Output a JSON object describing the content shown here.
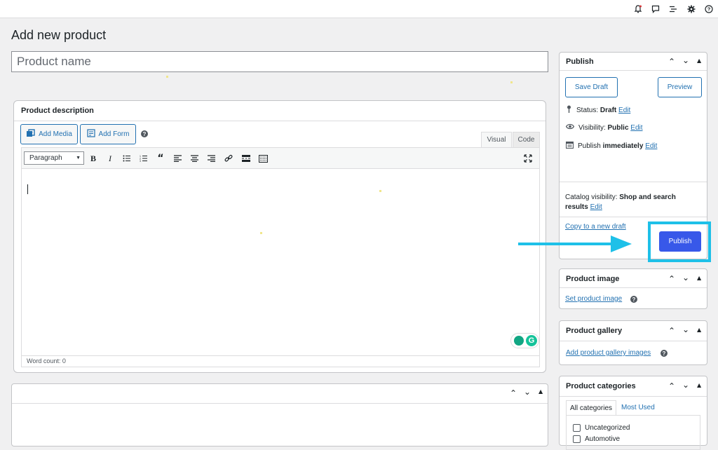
{
  "page": {
    "title": "Add new product"
  },
  "product_name": {
    "placeholder": "Product name",
    "value": ""
  },
  "description": {
    "title": "Product description",
    "add_media_label": "Add Media",
    "add_form_label": "Add Form",
    "tabs": {
      "visual": "Visual",
      "code": "Code"
    },
    "format_select": "Paragraph",
    "word_count": "Word count: 0"
  },
  "publish_box": {
    "title": "Publish",
    "save_draft_label": "Save Draft",
    "preview_label": "Preview",
    "status_label": "Status:",
    "status_value": "Draft",
    "visibility_label": "Visibility:",
    "visibility_value": "Public",
    "publish_label": "Publish",
    "publish_value": "immediately",
    "edit_label": "Edit",
    "catalog_label": "Catalog visibility:",
    "catalog_value": "Shop and search",
    "catalog_value_2": "results",
    "copy_draft_label": "Copy to a new draft",
    "publish_button_label": "Publish"
  },
  "product_image": {
    "title": "Product image",
    "link": "Set product image"
  },
  "product_gallery": {
    "title": "Product gallery",
    "link": "Add product gallery images"
  },
  "product_categories": {
    "title": "Product categories",
    "tabs": [
      "All categories",
      "Most Used"
    ],
    "items": [
      "Uncategorized",
      "Automotive"
    ]
  },
  "colors": {
    "accent": "#2271b1",
    "publish": "#3858e9",
    "annotation": "#1ec0e8"
  },
  "icons": [
    "bell-icon",
    "comment-icon",
    "list-icon",
    "gear-icon",
    "help-icon"
  ]
}
